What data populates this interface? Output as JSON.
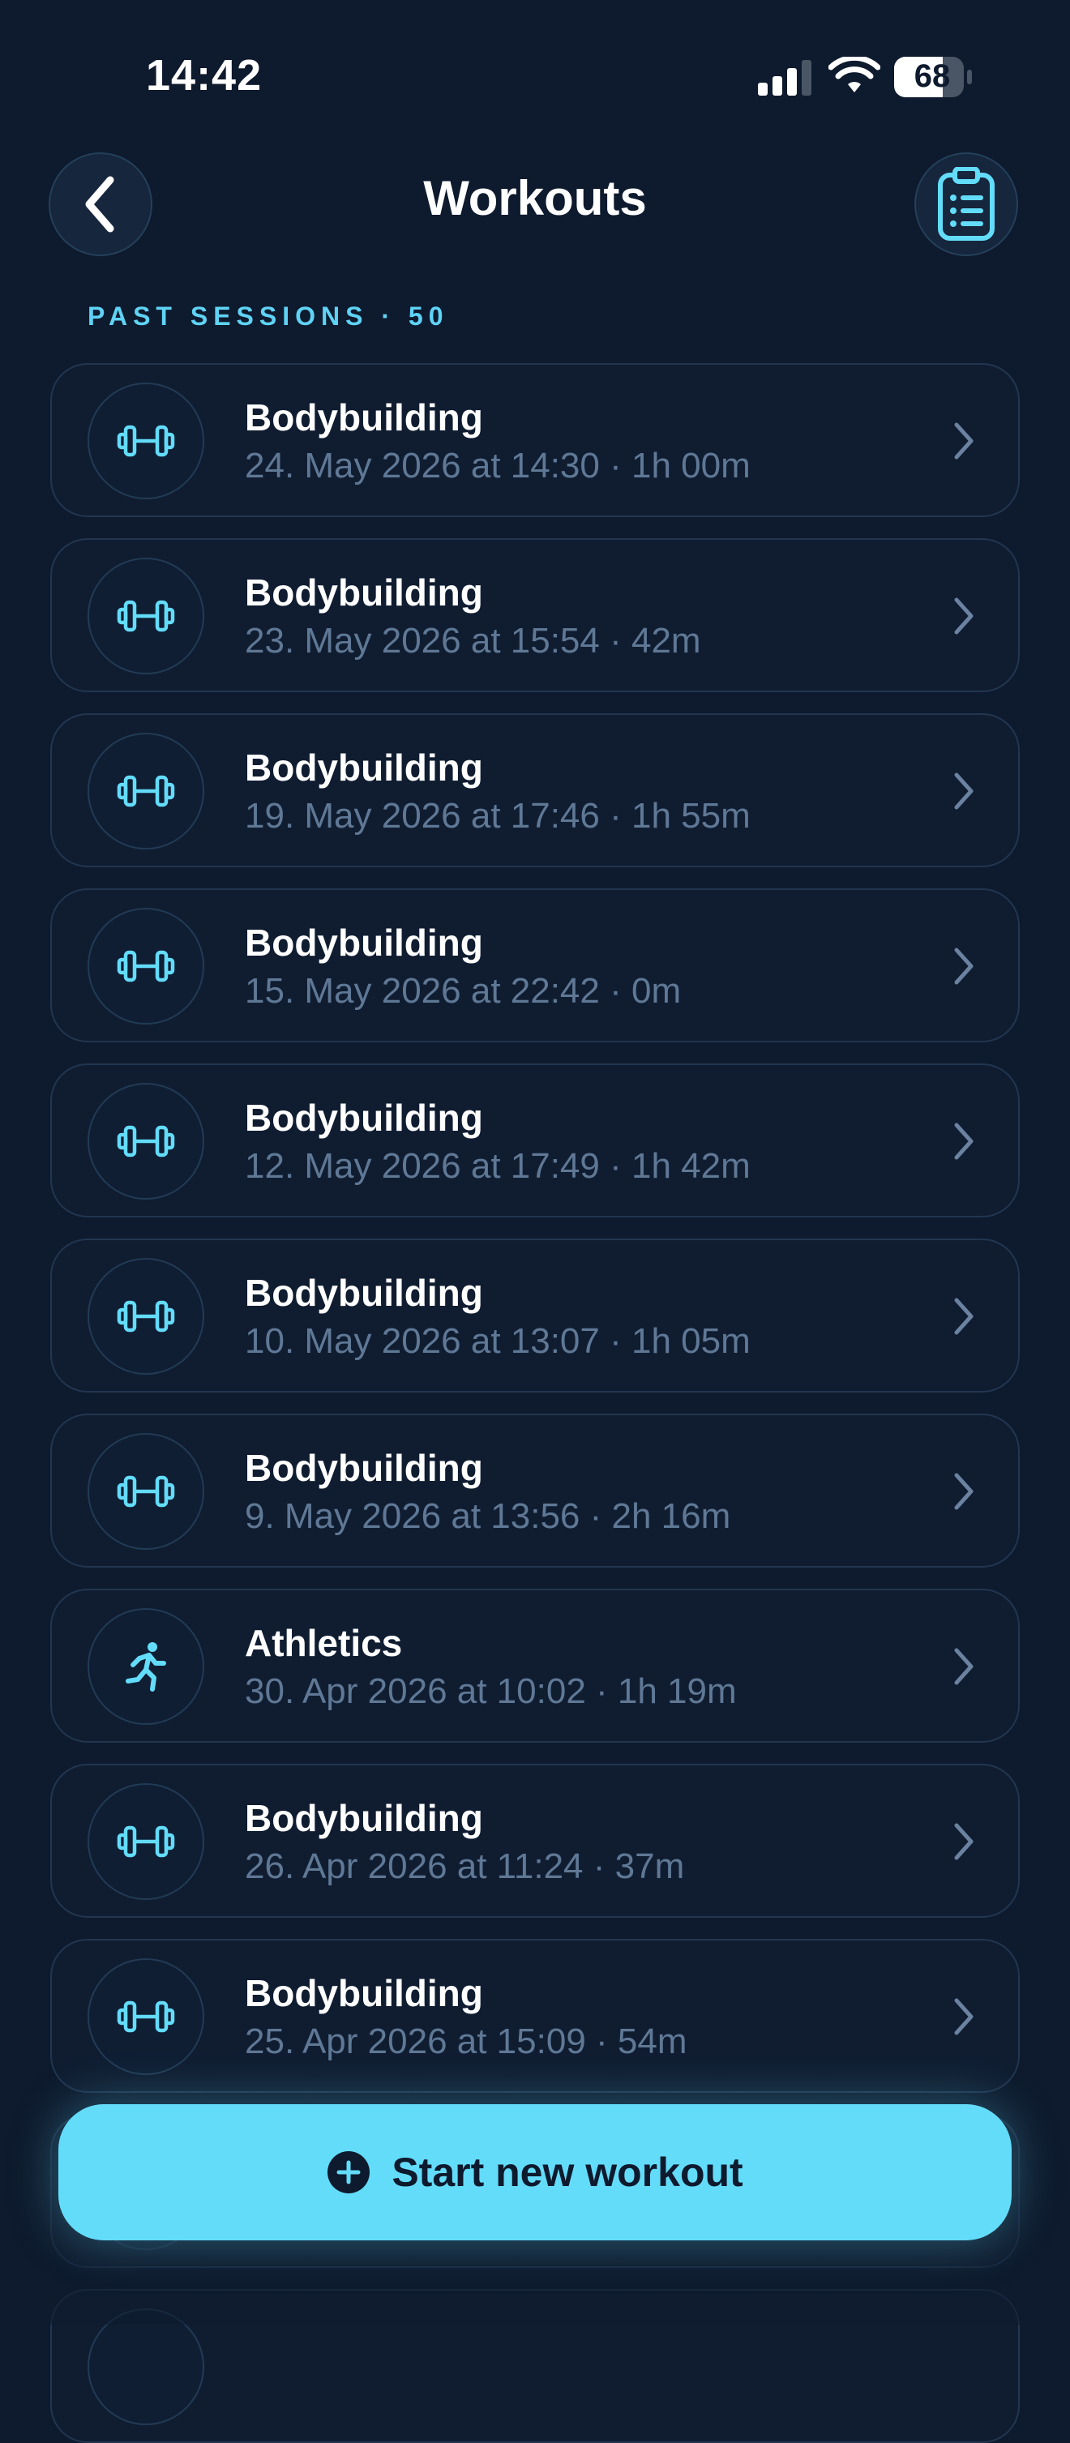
{
  "status_bar": {
    "time": "14:42",
    "battery": "68"
  },
  "header": {
    "title": "Workouts",
    "back_icon": "chevron-left-icon",
    "clipboard_icon": "clipboard-list-icon"
  },
  "section": {
    "label": "PAST SESSIONS · 50"
  },
  "sessions": [
    {
      "type": "Bodybuilding",
      "icon": "dumbbell-icon",
      "detail": "24. May 2026 at 14:30 · 1h 00m"
    },
    {
      "type": "Bodybuilding",
      "icon": "dumbbell-icon",
      "detail": "23. May 2026 at 15:54 · 42m"
    },
    {
      "type": "Bodybuilding",
      "icon": "dumbbell-icon",
      "detail": "19. May 2026 at 17:46 · 1h 55m"
    },
    {
      "type": "Bodybuilding",
      "icon": "dumbbell-icon",
      "detail": "15. May 2026 at 22:42 · 0m"
    },
    {
      "type": "Bodybuilding",
      "icon": "dumbbell-icon",
      "detail": "12. May 2026 at 17:49 · 1h 42m"
    },
    {
      "type": "Bodybuilding",
      "icon": "dumbbell-icon",
      "detail": "10. May 2026 at 13:07 · 1h 05m"
    },
    {
      "type": "Bodybuilding",
      "icon": "dumbbell-icon",
      "detail": "9. May 2026 at 13:56 · 2h 16m"
    },
    {
      "type": "Athletics",
      "icon": "running-icon",
      "detail": "30. Apr 2026 at 10:02 · 1h 19m"
    },
    {
      "type": "Bodybuilding",
      "icon": "dumbbell-icon",
      "detail": "26. Apr 2026 at 11:24 · 37m"
    },
    {
      "type": "Bodybuilding",
      "icon": "dumbbell-icon",
      "detail": "25. Apr 2026 at 15:09 · 54m"
    }
  ],
  "cta": {
    "label": "Start new workout",
    "icon": "plus-circle-icon"
  },
  "colors": {
    "background": "#0e1a2d",
    "accent": "#63dcfa",
    "muted_text": "#5f7895"
  }
}
